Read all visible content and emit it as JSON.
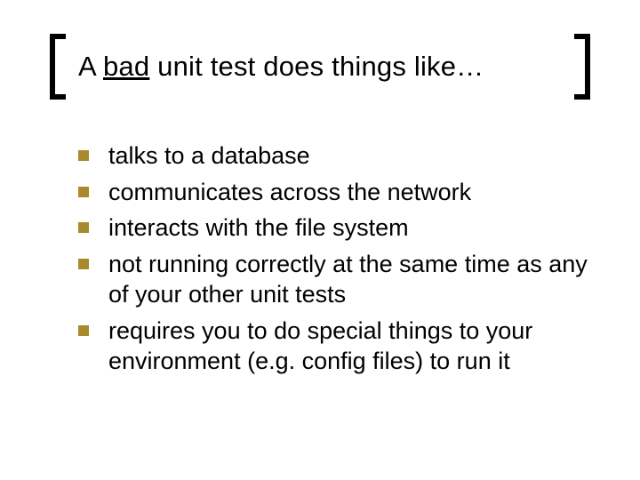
{
  "title": {
    "pre": "A ",
    "bad": "bad",
    "post": " unit test does things like…"
  },
  "bullets": [
    "talks to a database",
    "communicates across the network",
    "interacts with the file system",
    "not running correctly at the same time as any of your other unit tests",
    "requires you to do special things to your environment (e.g. config files) to run it"
  ],
  "colors": {
    "bullet": "#a88a2a"
  }
}
